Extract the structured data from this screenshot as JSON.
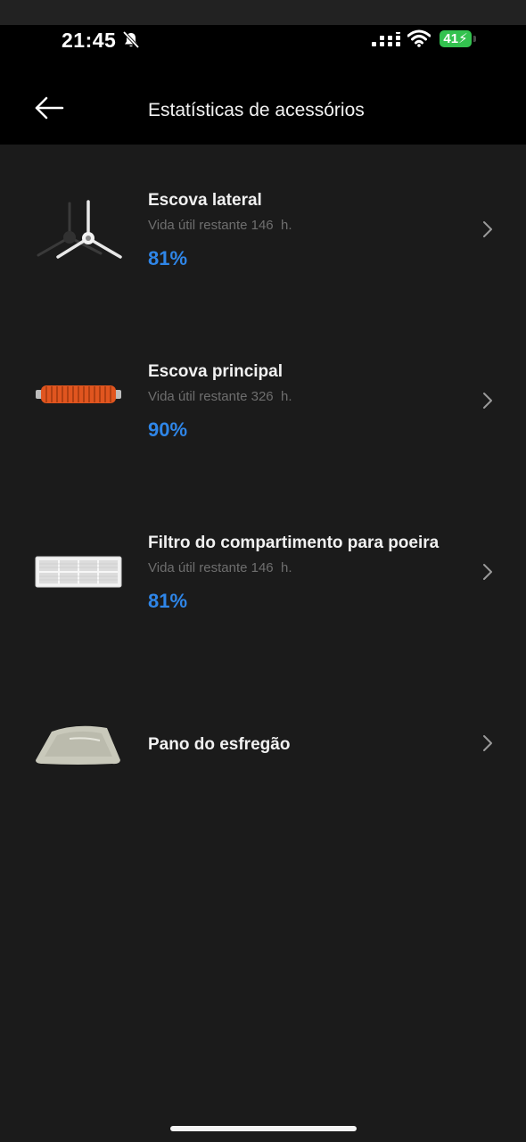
{
  "status_bar": {
    "time": "21:45",
    "battery": "41"
  },
  "header": {
    "title": "Estatísticas de acessórios"
  },
  "colors": {
    "accent": "#2f86e8",
    "background": "#1b1b1b",
    "header_bg": "#000000",
    "battery": "#33c24f"
  },
  "items": [
    {
      "name": "Escova lateral",
      "life": "Vida útil restante 146  h.",
      "percent": "81%",
      "icon": "side-brush-image"
    },
    {
      "name": "Escova principal",
      "life": "Vida útil restante 326  h.",
      "percent": "90%",
      "icon": "main-brush-image"
    },
    {
      "name": "Filtro do compartimento para poeira",
      "life": "Vida útil restante 146  h.",
      "percent": "81%",
      "icon": "dust-filter-image"
    },
    {
      "name": "Pano do esfregão",
      "icon": "mop-cloth-image"
    }
  ]
}
